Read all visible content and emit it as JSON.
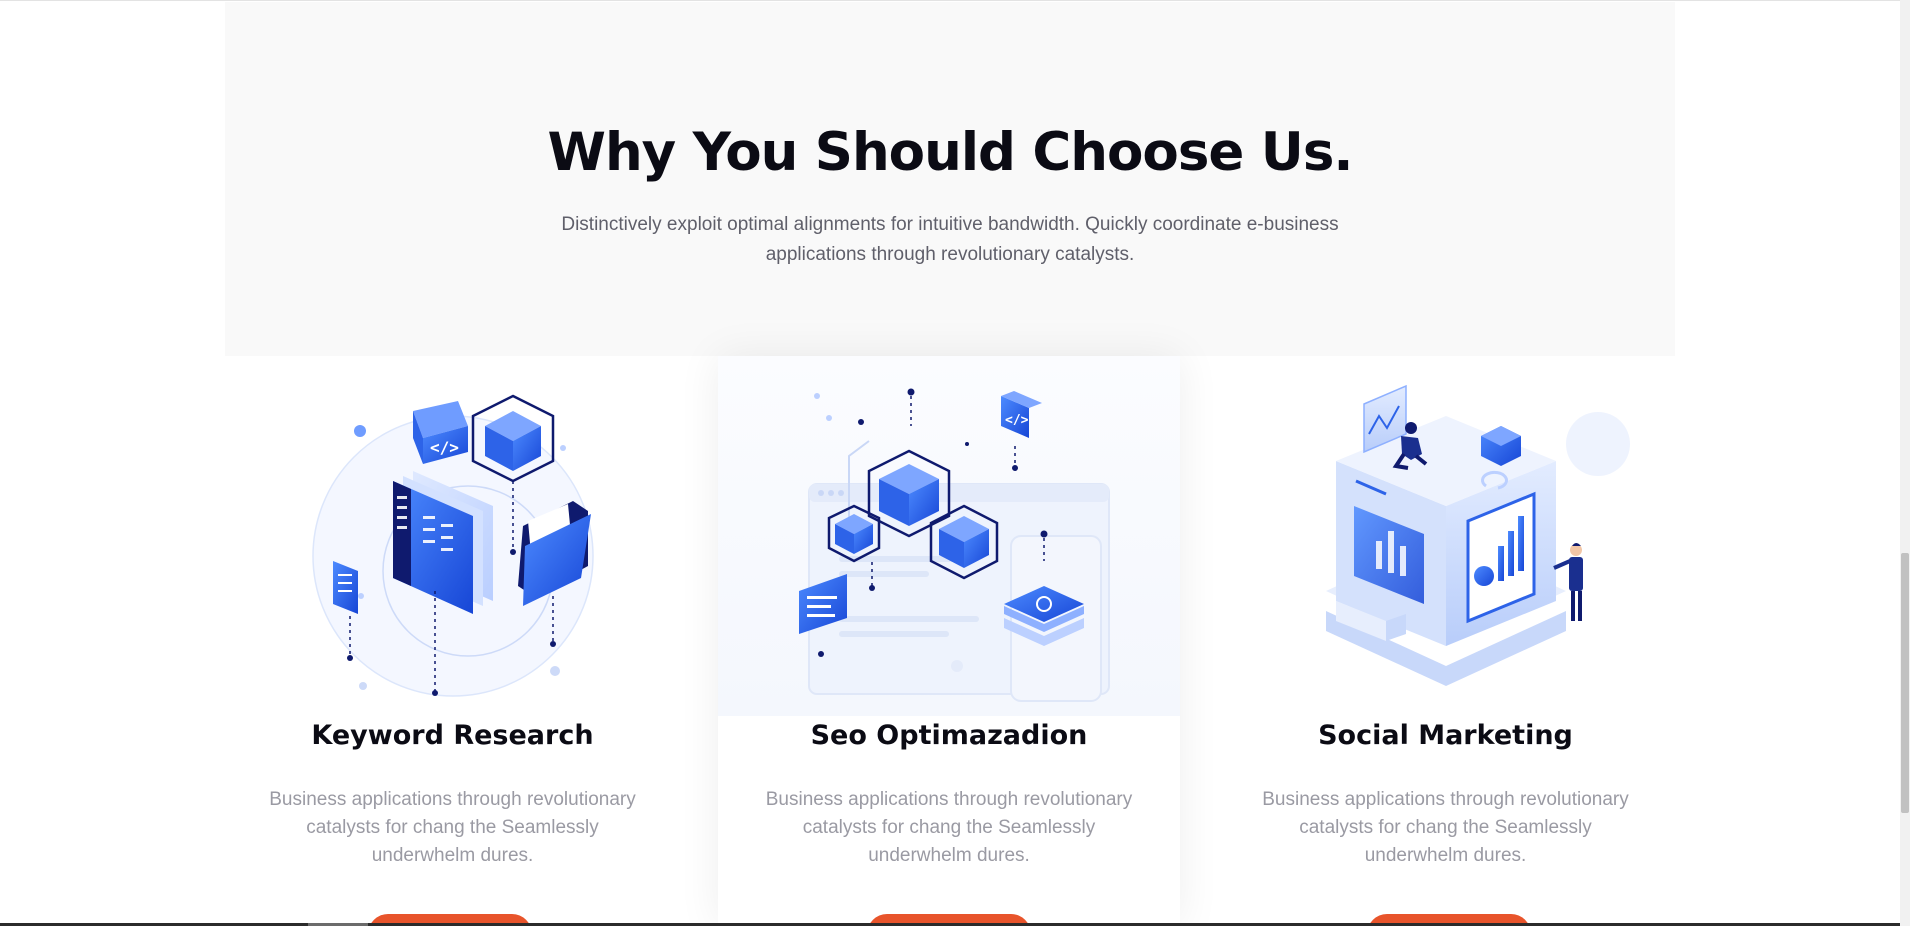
{
  "section": {
    "title": "Why You Should Choose Us.",
    "subtitle_line1": "Distinctively exploit optimal alignments for intuitive bandwidth. Quickly coordinate e-business",
    "subtitle_line2": "applications through revolutionary catalysts."
  },
  "cards": [
    {
      "title": "Keyword Research",
      "text": "Business applications through revolutionary catalysts for chang the Seamlessly underwhelm dures.",
      "illustration": "keyword-research-illustration"
    },
    {
      "title": "Seo Optimazadion",
      "text": "Business applications through revolutionary catalysts for chang the Seamlessly underwhelm dures.",
      "illustration": "seo-optimization-illustration"
    },
    {
      "title": "Social Marketing",
      "text": "Business applications through revolutionary catalysts for chang the Seamlessly underwhelm dures.",
      "illustration": "social-marketing-illustration"
    }
  ],
  "colors": {
    "hero_background": "#f9f9f9",
    "heading": "#0b0b14",
    "body_text": "#9a9aa3",
    "accent_blue": "#1a5cf0",
    "navy": "#0f1a6e",
    "button": "#e8542b"
  }
}
